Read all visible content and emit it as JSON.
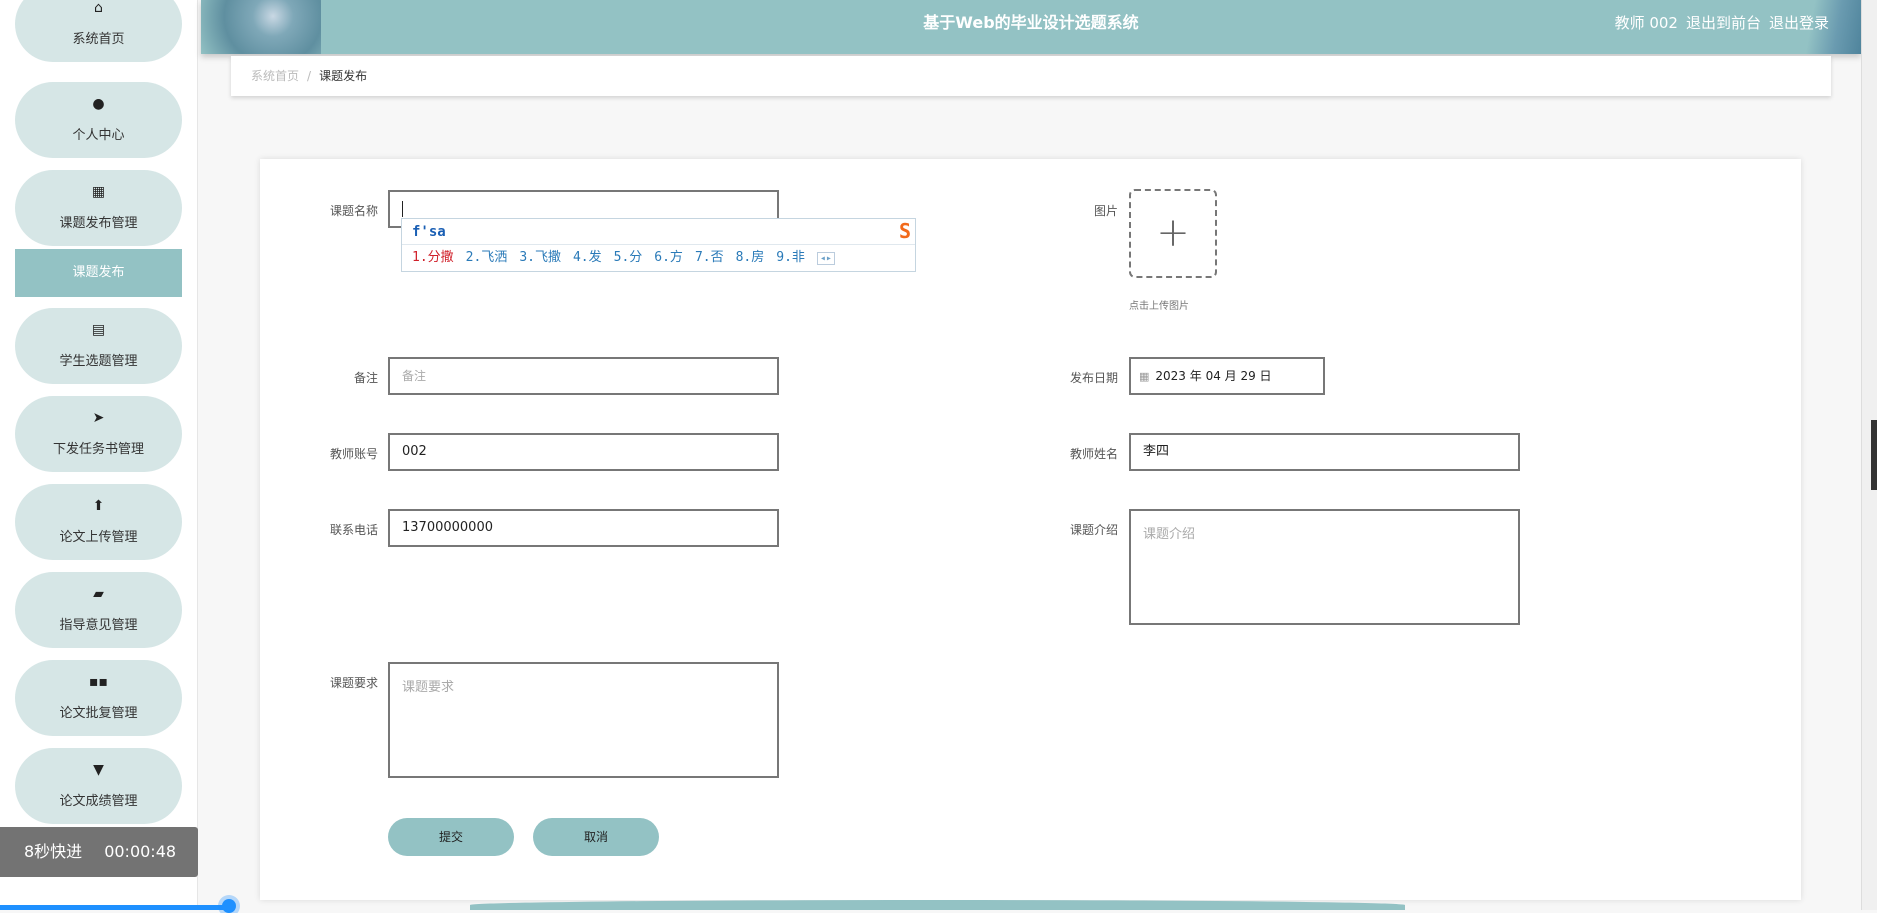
{
  "header": {
    "title": "基于Web的毕业设计选题系统",
    "user": "教师 002",
    "to_front": "退出到前台",
    "logout": "退出登录"
  },
  "sidebar": {
    "items": [
      {
        "label": "系统首页",
        "icon": "home-icon",
        "glyph": "⌂"
      },
      {
        "label": "个人中心",
        "icon": "user-icon",
        "glyph": "●"
      },
      {
        "label": "课题发布管理",
        "icon": "grid-icon",
        "glyph": "▦"
      },
      {
        "label": "学生选题管理",
        "icon": "clipboard-icon",
        "glyph": "▤"
      },
      {
        "label": "下发任务书管理",
        "icon": "send-icon",
        "glyph": "➤"
      },
      {
        "label": "论文上传管理",
        "icon": "upload-icon",
        "glyph": "⬆"
      },
      {
        "label": "指导意见管理",
        "icon": "briefcase-icon",
        "glyph": "▰"
      },
      {
        "label": "论文批复管理",
        "icon": "apps-icon",
        "glyph": "▪▪"
      },
      {
        "label": "论文成绩管理",
        "icon": "pin-icon",
        "glyph": "▼"
      }
    ],
    "sub_item": "课题发布"
  },
  "breadcrumb": {
    "home": "系统首页",
    "sep": "/",
    "current": "课题发布"
  },
  "form": {
    "title_label": "课题名称",
    "title_value": "",
    "image_label": "图片",
    "upload_hint": "点击上传图片",
    "remark_label": "备注",
    "remark_placeholder": "备注",
    "date_label": "发布日期",
    "date_value": "2023 年 04 月 29 日",
    "teacher_account_label": "教师账号",
    "teacher_account_value": "002",
    "teacher_name_label": "教师姓名",
    "teacher_name_value": "李四",
    "phone_label": "联系电话",
    "phone_value": "13700000000",
    "intro_label": "课题介绍",
    "intro_placeholder": "课题介绍",
    "req_label": "课题要求",
    "req_placeholder": "课题要求",
    "submit": "提交",
    "cancel": "取消"
  },
  "ime": {
    "composition": "f'sa",
    "candidates": [
      "1.分撒",
      "2.飞洒",
      "3.飞撒",
      "4.发",
      "5.分",
      "6.方",
      "7.否",
      "8.房",
      "9.非"
    ],
    "logo": "S"
  },
  "player": {
    "skip_label": "8秒快进",
    "time": "00:00:48"
  }
}
